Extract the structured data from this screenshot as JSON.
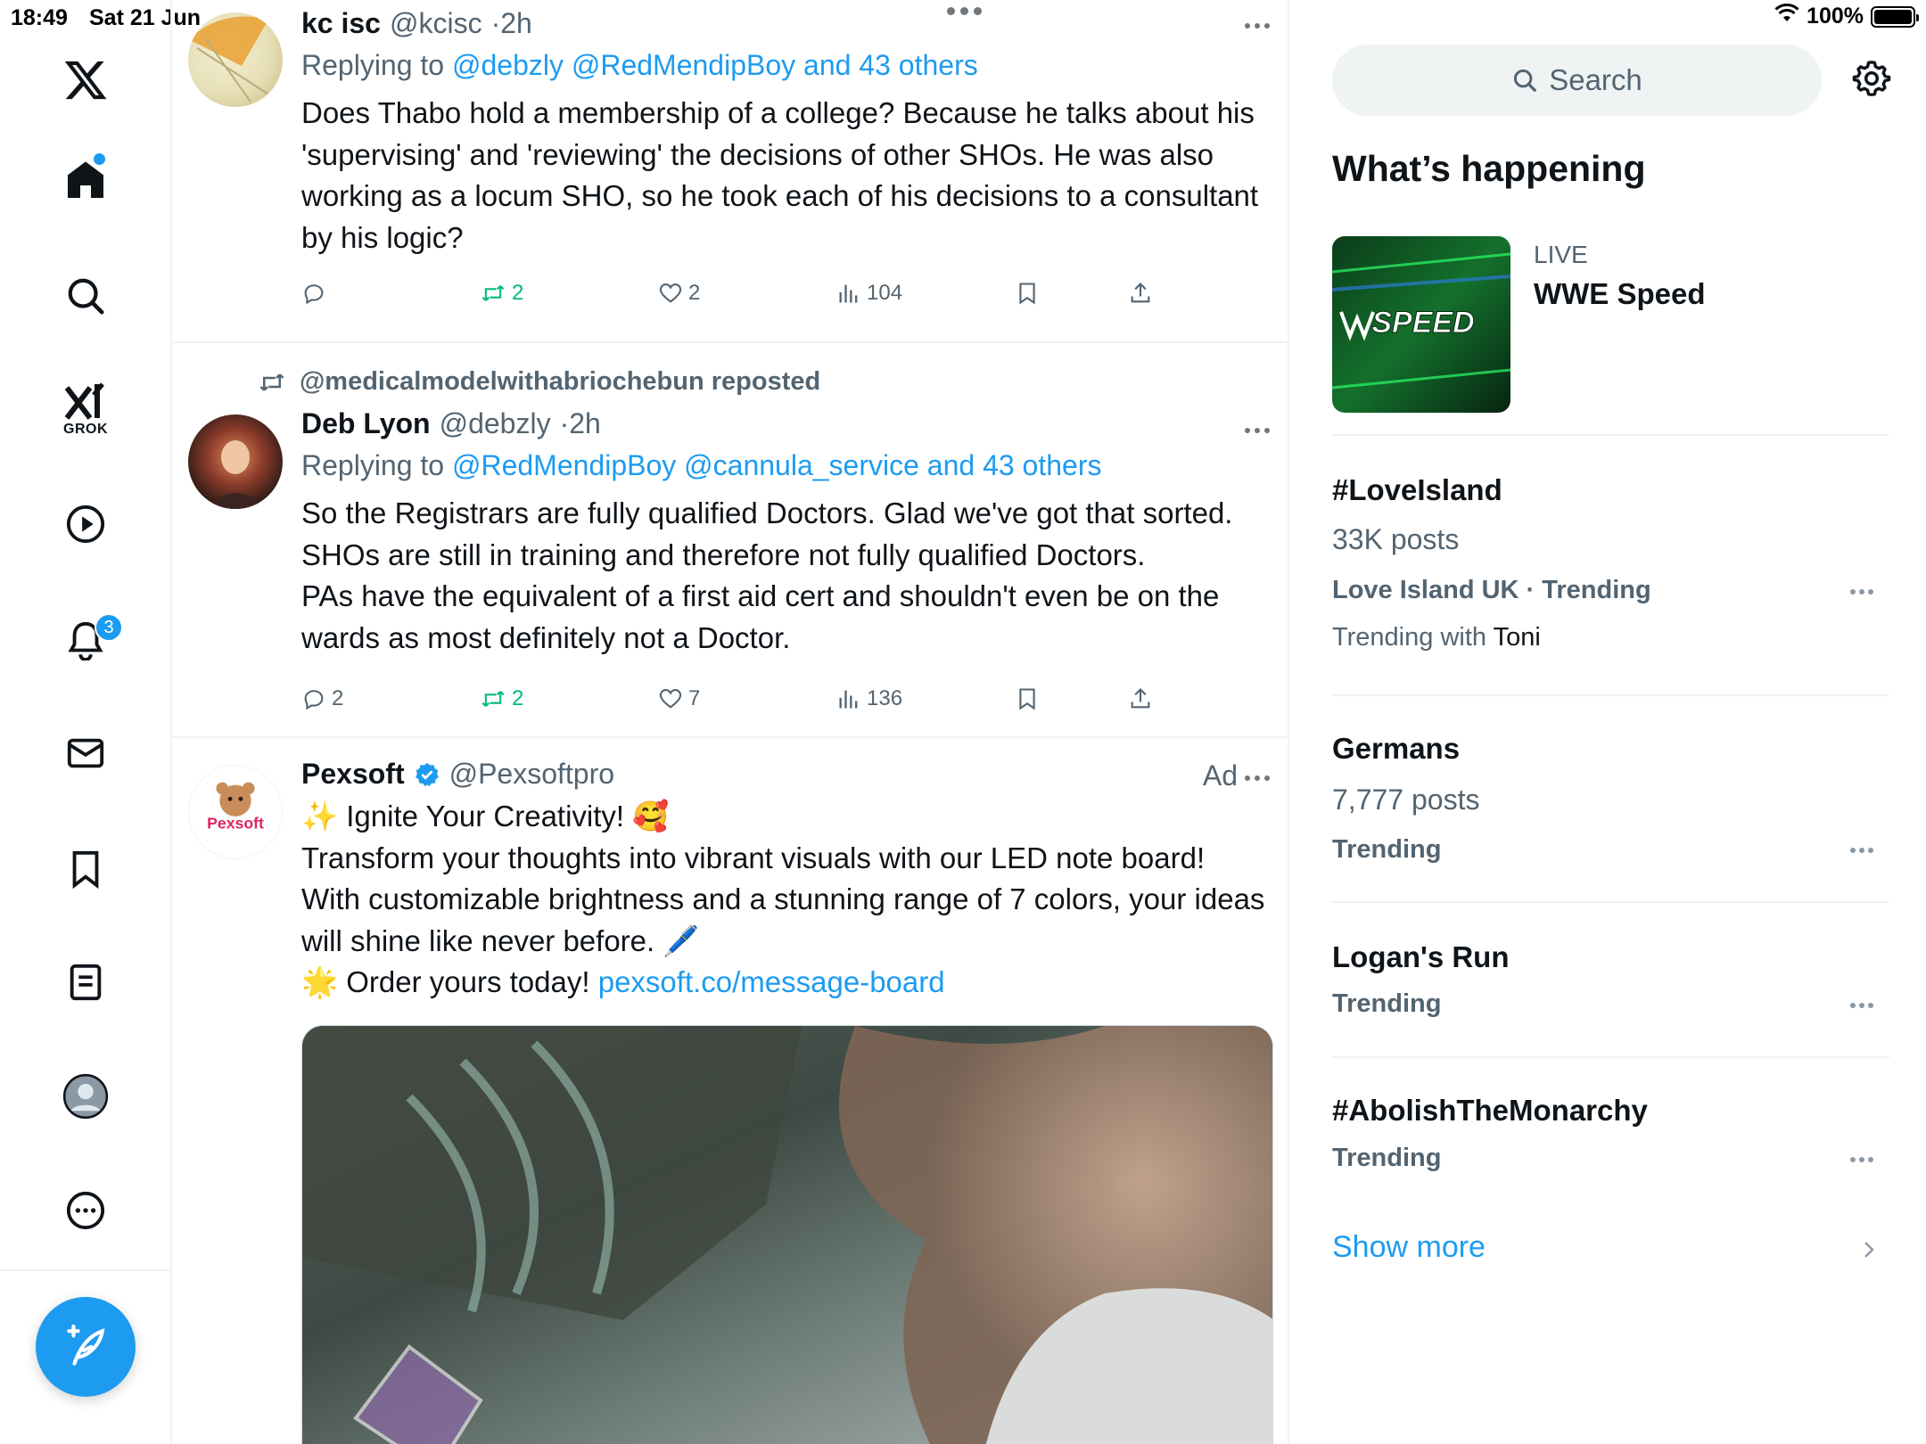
{
  "status": {
    "time": "18:49",
    "date": "Sat 21 Jun",
    "battery": "100%",
    "battery_level": 1.0
  },
  "nav": {
    "items": [
      "home",
      "explore",
      "grok",
      "videos",
      "notifications",
      "messages",
      "bookmarks",
      "lists",
      "profile",
      "more"
    ],
    "grok_label": "GROK",
    "notifications_count": "3"
  },
  "feed": {
    "tweets": [
      {
        "name": "kc isc",
        "handle": "@kcisc",
        "time": "2h",
        "replying_prefix": "Replying to",
        "replying_to": "@debzly @RedMendipBoy and 43 others",
        "text": "Does Thabo hold a membership of a college? Because he talks about his 'supervising' and 'reviewing'  the decisions of other SHOs. He was also working as a locum SHO, so he took each of his decisions to a consultant by his logic?",
        "replies": "",
        "reposts": "2",
        "likes": "2",
        "views": "104"
      },
      {
        "reposted_by": "@medicalmodelwithabriochebun reposted",
        "name": "Deb Lyon",
        "handle": "@debzly",
        "time": "2h",
        "replying_prefix": "Replying to",
        "replying_to": "@RedMendipBoy @cannula_service and 43 others",
        "text_lines": [
          "So the Registrars are fully qualified Doctors. Glad we've got that sorted.",
          "SHOs are still in training and therefore not fully qualified Doctors.",
          "PAs have the equivalent of a first aid cert and shouldn't even be on the wards as most definitely not a Doctor."
        ],
        "replies": "2",
        "reposts": "2",
        "likes": "7",
        "views": "136"
      },
      {
        "name": "Pexsoft",
        "handle": "@Pexsoftpro",
        "ad_label": "Ad",
        "avatar_text": "Pexsoft",
        "line1": "✨ Ignite Your Creativity! 🥰",
        "line2": "Transform your thoughts into vibrant visuals with our LED note board! With customizable brightness and a stunning range of 7 colors, your ideas will shine like never before. 🖊️",
        "line3_prefix": "🌟 Order yours today!",
        "link": "pexsoft.co/message-board"
      }
    ]
  },
  "sidebar": {
    "search_placeholder": "Search",
    "whats_happening": "What’s happening",
    "live": {
      "label": "LIVE",
      "title": "WWE Speed",
      "thumb_text": "SPEED"
    },
    "trends": [
      {
        "title": "#LoveIsland",
        "posts": "33K posts",
        "category": "Love Island UK · Trending",
        "with_prefix": "Trending with",
        "with_name": "Toni"
      },
      {
        "title": "Germans",
        "posts": "7,777 posts",
        "category": "Trending"
      },
      {
        "title": "Logan's Run",
        "category": "Trending"
      },
      {
        "title": "#AbolishTheMonarchy",
        "category": "Trending"
      }
    ],
    "show_more": "Show more"
  },
  "colors": {
    "accent": "#1d9bf0",
    "repost_green": "#00ba7c",
    "secondary_text": "#536471",
    "divider": "#eff3f4"
  }
}
